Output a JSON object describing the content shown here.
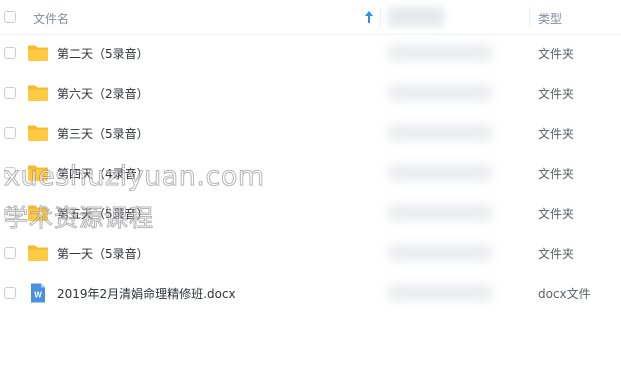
{
  "header": {
    "name_label": "文件名",
    "type_label": "类型"
  },
  "files": [
    {
      "name": "第二天（5录音）",
      "type": "文件夹",
      "icon": "folder-icon"
    },
    {
      "name": "第六天（2录音）",
      "type": "文件夹",
      "icon": "folder-icon"
    },
    {
      "name": "第三天（5录音）",
      "type": "文件夹",
      "icon": "folder-icon"
    },
    {
      "name": "第四天（4录音）",
      "type": "文件夹",
      "icon": "folder-icon"
    },
    {
      "name": "第五天（5录音）",
      "type": "文件夹",
      "icon": "folder-icon"
    },
    {
      "name": "第一天（5录音）",
      "type": "文件夹",
      "icon": "folder-icon"
    },
    {
      "name": "2019年2月清娟命理精修班.docx",
      "type": "docx文件",
      "icon": "word-doc-icon"
    }
  ],
  "watermark": {
    "line1": "xueshuziyuan.com",
    "line2": "学术资源课程"
  },
  "colors": {
    "folder": "#ffc940",
    "folder_tab": "#f5b82e",
    "word_doc": "#4a90e2",
    "sort_arrow": "#2d8cf0"
  }
}
